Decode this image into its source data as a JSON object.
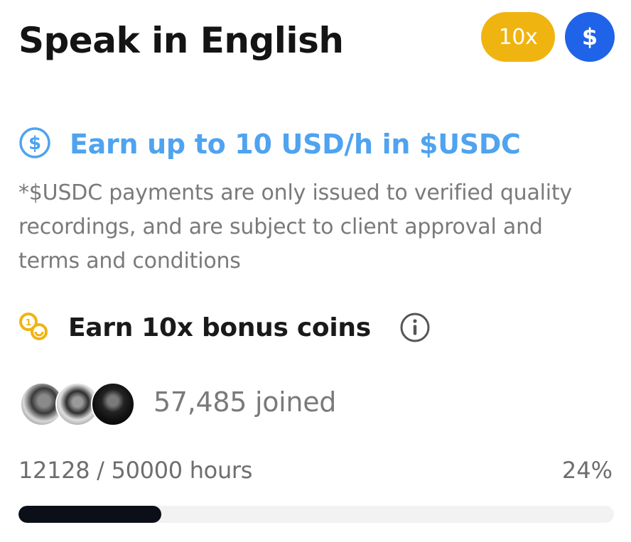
{
  "header": {
    "title": "Speak in English",
    "multiplier_badge": "10x",
    "currency_badge": "$"
  },
  "earn": {
    "icon": "dollar-circle-icon",
    "text": "Earn up to 10 USD/h in $USDC",
    "disclaimer": "*$USDC payments are only issued to verified quality recordings, and are subject to client approval and terms and conditions"
  },
  "bonus": {
    "icon": "coins-icon",
    "text": "Earn 10x bonus coins",
    "info_icon": "info-icon"
  },
  "participants": {
    "joined_text": "57,485 joined"
  },
  "progress": {
    "hours_text": "12128 / 50000 hours",
    "percent_text": "24%",
    "fraction": 0.24
  },
  "colors": {
    "accent_yellow": "#F0B410",
    "accent_blue": "#1F63E8",
    "earn_blue": "#4FA3F0",
    "progress_fill": "#0b0f17"
  }
}
